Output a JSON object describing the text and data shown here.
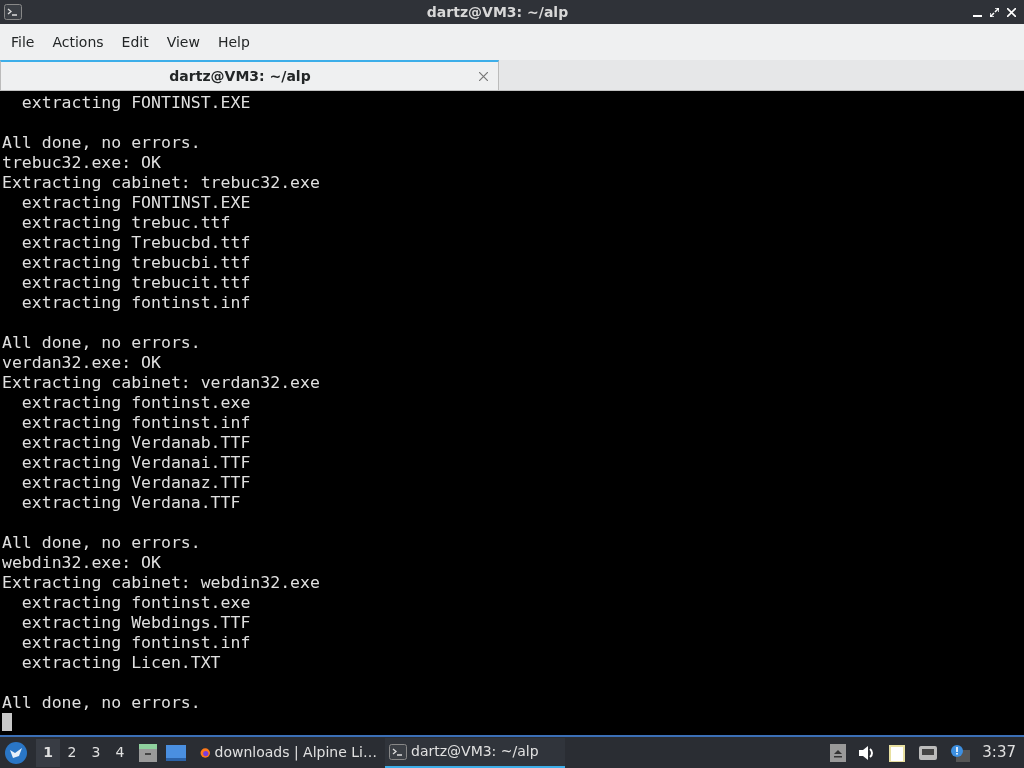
{
  "window": {
    "title": "dartz@VM3: ~/alp"
  },
  "menu": [
    "File",
    "Actions",
    "Edit",
    "View",
    "Help"
  ],
  "tabs": [
    {
      "label": "dartz@VM3: ~/alp",
      "selected": true
    }
  ],
  "terminal": {
    "blocks": [
      [
        "  extracting FONTINST.EXE"
      ],
      [
        "All done, no errors.",
        "trebuc32.exe: OK",
        "Extracting cabinet: trebuc32.exe",
        "  extracting FONTINST.EXE",
        "  extracting trebuc.ttf",
        "  extracting Trebucbd.ttf",
        "  extracting trebucbi.ttf",
        "  extracting trebucit.ttf",
        "  extracting fontinst.inf"
      ],
      [
        "All done, no errors.",
        "verdan32.exe: OK",
        "Extracting cabinet: verdan32.exe",
        "  extracting fontinst.exe",
        "  extracting fontinst.inf",
        "  extracting Verdanab.TTF",
        "  extracting Verdanai.TTF",
        "  extracting Verdanaz.TTF",
        "  extracting Verdana.TTF"
      ],
      [
        "All done, no errors.",
        "webdin32.exe: OK",
        "Extracting cabinet: webdin32.exe",
        "  extracting fontinst.exe",
        "  extracting Webdings.TTF",
        "  extracting fontinst.inf",
        "  extracting Licen.TXT"
      ],
      [
        "All done, no errors."
      ]
    ],
    "cursor": true
  },
  "taskbar": {
    "workspaces": [
      {
        "label": "1",
        "selected": true
      },
      {
        "label": "2",
        "selected": false
      },
      {
        "label": "3",
        "selected": false
      },
      {
        "label": "4",
        "selected": false
      }
    ],
    "tasks": [
      {
        "kind": "browser",
        "label": "downloads | Alpine Li…",
        "selected": false
      },
      {
        "kind": "terminal",
        "label": "dartz@VM3: ~/alp",
        "selected": true
      }
    ],
    "clock": "3:37"
  }
}
